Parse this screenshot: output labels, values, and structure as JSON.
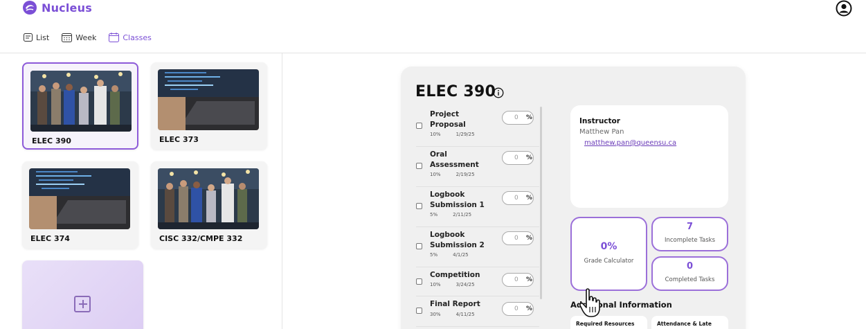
{
  "app": {
    "name": "Nucleus",
    "brand_color": "#7b4fd6"
  },
  "view_tabs": [
    {
      "label": "List",
      "icon": "list-icon",
      "active": false
    },
    {
      "label": "Week",
      "icon": "calendar-grid-icon",
      "active": false
    },
    {
      "label": "Classes",
      "icon": "calendar-icon",
      "active": true
    }
  ],
  "classes": [
    {
      "label": "ELEC 390",
      "thumb": "group-photo",
      "selected": true
    },
    {
      "label": "ELEC 373",
      "thumb": "laptop-photo",
      "selected": false
    },
    {
      "label": "ELEC 374",
      "thumb": "laptop-photo",
      "selected": false
    },
    {
      "label": "CISC 332/CMPE 332",
      "thumb": "group-photo",
      "selected": false
    }
  ],
  "detail": {
    "title": "ELEC 390",
    "tasks": [
      {
        "name": "Project Proposal",
        "weight": "10%",
        "due": "1/29/25",
        "value": "0",
        "unit": "%"
      },
      {
        "name": "Oral Assessment",
        "weight": "10%",
        "due": "2/19/25",
        "value": "0",
        "unit": "%"
      },
      {
        "name": "Logbook Submission 1",
        "weight": "5%",
        "due": "2/11/25",
        "value": "0",
        "unit": "%"
      },
      {
        "name": "Logbook Submission 2",
        "weight": "5%",
        "due": "4/1/25",
        "value": "0",
        "unit": "%"
      },
      {
        "name": "Competition",
        "weight": "10%",
        "due": "3/24/25",
        "value": "0",
        "unit": "%"
      },
      {
        "name": "Final Report",
        "weight": "30%",
        "due": "4/11/25",
        "value": "0",
        "unit": "%"
      }
    ],
    "instructor": {
      "heading": "Instructor",
      "name": "Matthew Pan",
      "email": "matthew.pan@queensu.ca"
    },
    "grade": {
      "value": "0%",
      "label": "Grade Calculator"
    },
    "incomplete": {
      "value": "7",
      "label": "Incomplete Tasks"
    },
    "completed": {
      "value": "0",
      "label": "Completed Tasks"
    },
    "additional_heading": "Additional Information",
    "chips": [
      "Required Resources",
      "Attendance & Late"
    ]
  }
}
